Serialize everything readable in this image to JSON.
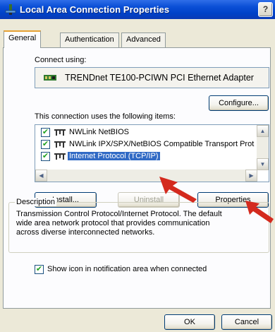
{
  "window": {
    "title": "Local Area Connection Properties",
    "help_label": "?"
  },
  "tabs": [
    {
      "label": "General"
    },
    {
      "label": "Authentication"
    },
    {
      "label": "Advanced"
    }
  ],
  "general": {
    "connect_using_label": "Connect using:",
    "adapter_name": "TRENDnet TE100-PCIWN PCI Ethernet Adapter",
    "configure_label": "Configure...",
    "items_label": "This connection uses the following items:",
    "items": [
      {
        "label": "NWLink NetBIOS",
        "checked": true,
        "selected": false
      },
      {
        "label": "NWLink IPX/SPX/NetBIOS Compatible Transport Prot",
        "checked": true,
        "selected": false
      },
      {
        "label": "Internet Protocol (TCP/IP)",
        "checked": true,
        "selected": true
      }
    ],
    "install_label": "Install...",
    "uninstall_label": "Uninstall",
    "properties_label": "Properties",
    "description": {
      "title": "Description",
      "line1": "Transmission Control Protocol/Internet Protocol. The default",
      "line2": "wide area network protocol that provides communication",
      "line3": "across diverse interconnected networks."
    },
    "show_icon_label": "Show icon in notification area when connected",
    "show_icon_checked": true
  },
  "footer": {
    "ok_label": "OK",
    "cancel_label": "Cancel"
  },
  "colors": {
    "titlebar": "#0b4fd6",
    "selection": "#316ac5",
    "annotation_arrow": "#d42a1e"
  }
}
